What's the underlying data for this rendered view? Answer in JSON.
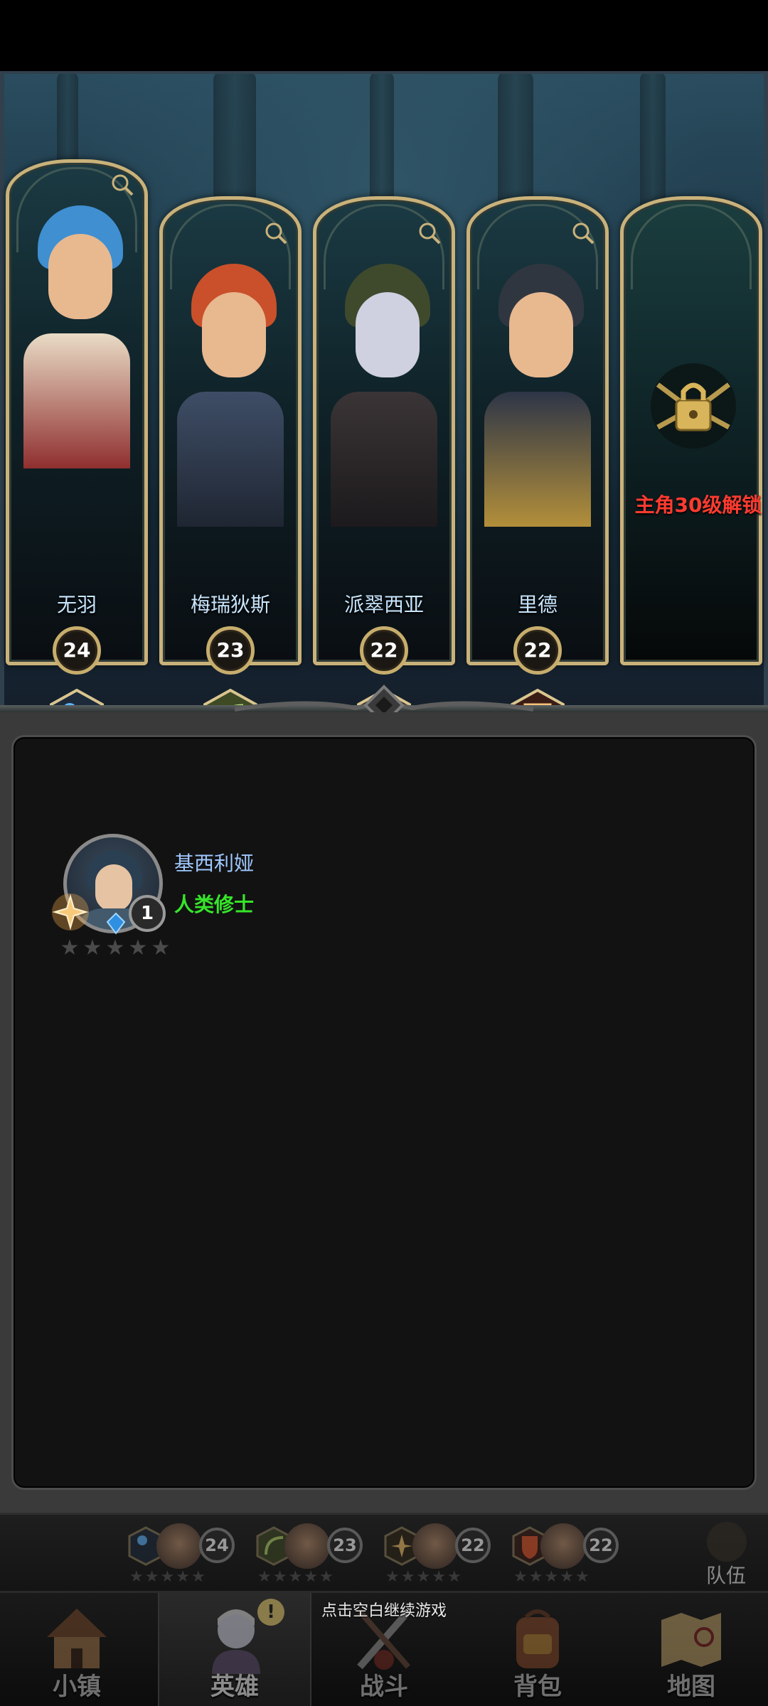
{
  "heroes": [
    {
      "name": "无羽",
      "level": "24",
      "class_icon": "staff-icon",
      "hair_color": "#3f8fd1",
      "body_color": "#e9dcc6"
    },
    {
      "name": "梅瑞狄斯",
      "level": "23",
      "class_icon": "bow-icon",
      "hair_color": "#c9502a",
      "body_color": "#3e4d66"
    },
    {
      "name": "派翠西亚",
      "level": "22",
      "class_icon": "holy-cross-icon",
      "hair_color": "#3f4a2d",
      "body_color": "#3a3436"
    },
    {
      "name": "里德",
      "level": "22",
      "class_icon": "shield-icon",
      "hair_color": "#2f3640",
      "body_color": "#2d3547"
    }
  ],
  "locked_slot": {
    "unlock_text": "主角30级解锁"
  },
  "hero_list": {
    "entries": [
      {
        "name": "基西利娅",
        "class_name": "人类修士",
        "level": "1",
        "stars": 5,
        "stars_filled": 0
      }
    ]
  },
  "team_strip": {
    "slots": [
      {
        "level": "24"
      },
      {
        "level": "23"
      },
      {
        "level": "22"
      },
      {
        "level": "22"
      }
    ],
    "team_label": "队伍"
  },
  "continue_hint": "点击空白继续游戏",
  "nav": [
    {
      "label": "小镇",
      "icon": "town-icon"
    },
    {
      "label": "英雄",
      "icon": "hero-icon",
      "active": true,
      "alert": "!"
    },
    {
      "label": "战斗",
      "icon": "battle-icon"
    },
    {
      "label": "背包",
      "icon": "backpack-icon"
    },
    {
      "label": "地图",
      "icon": "map-icon"
    }
  ],
  "colors": {
    "accent_gold": "#c9b27a",
    "hero_name": "#c8e6ff",
    "unlock_red": "#ff3b30",
    "class_green": "#36e52a",
    "entry_name_blue": "#9fc8ff"
  }
}
